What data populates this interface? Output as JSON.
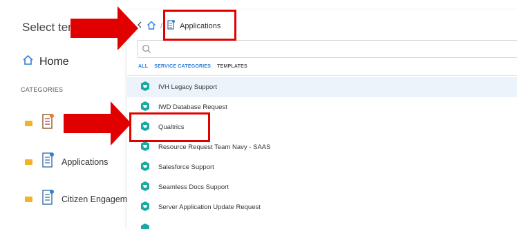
{
  "background": {
    "title": "Select tem",
    "home_label": "Home",
    "categories_heading": "CATEGORIES",
    "categories": [
      {
        "label": ""
      },
      {
        "label": "Applications"
      },
      {
        "label": "Citizen Engagem"
      }
    ]
  },
  "panel": {
    "breadcrumb_current": "Applications",
    "search_placeholder": "",
    "tabs": [
      {
        "label": "ALL",
        "active": true
      },
      {
        "label": "SERVICE CATEGORIES",
        "active": false
      },
      {
        "label": "TEMPLATES",
        "active": false
      }
    ],
    "items": [
      {
        "label": "IVH Legacy Support"
      },
      {
        "label": "IWD Database Request"
      },
      {
        "label": "Qualtrics"
      },
      {
        "label": "Resource Request Team Navy - SAAS"
      },
      {
        "label": "Salesforce Support"
      },
      {
        "label": "Seamless Docs Support"
      },
      {
        "label": "Server Application Update Request"
      }
    ]
  },
  "colors": {
    "accent": "#2f7fd6",
    "service_icon": "#1aa9a3",
    "annotation_red": "#e00000",
    "highlight_row": "#edf3fa"
  }
}
